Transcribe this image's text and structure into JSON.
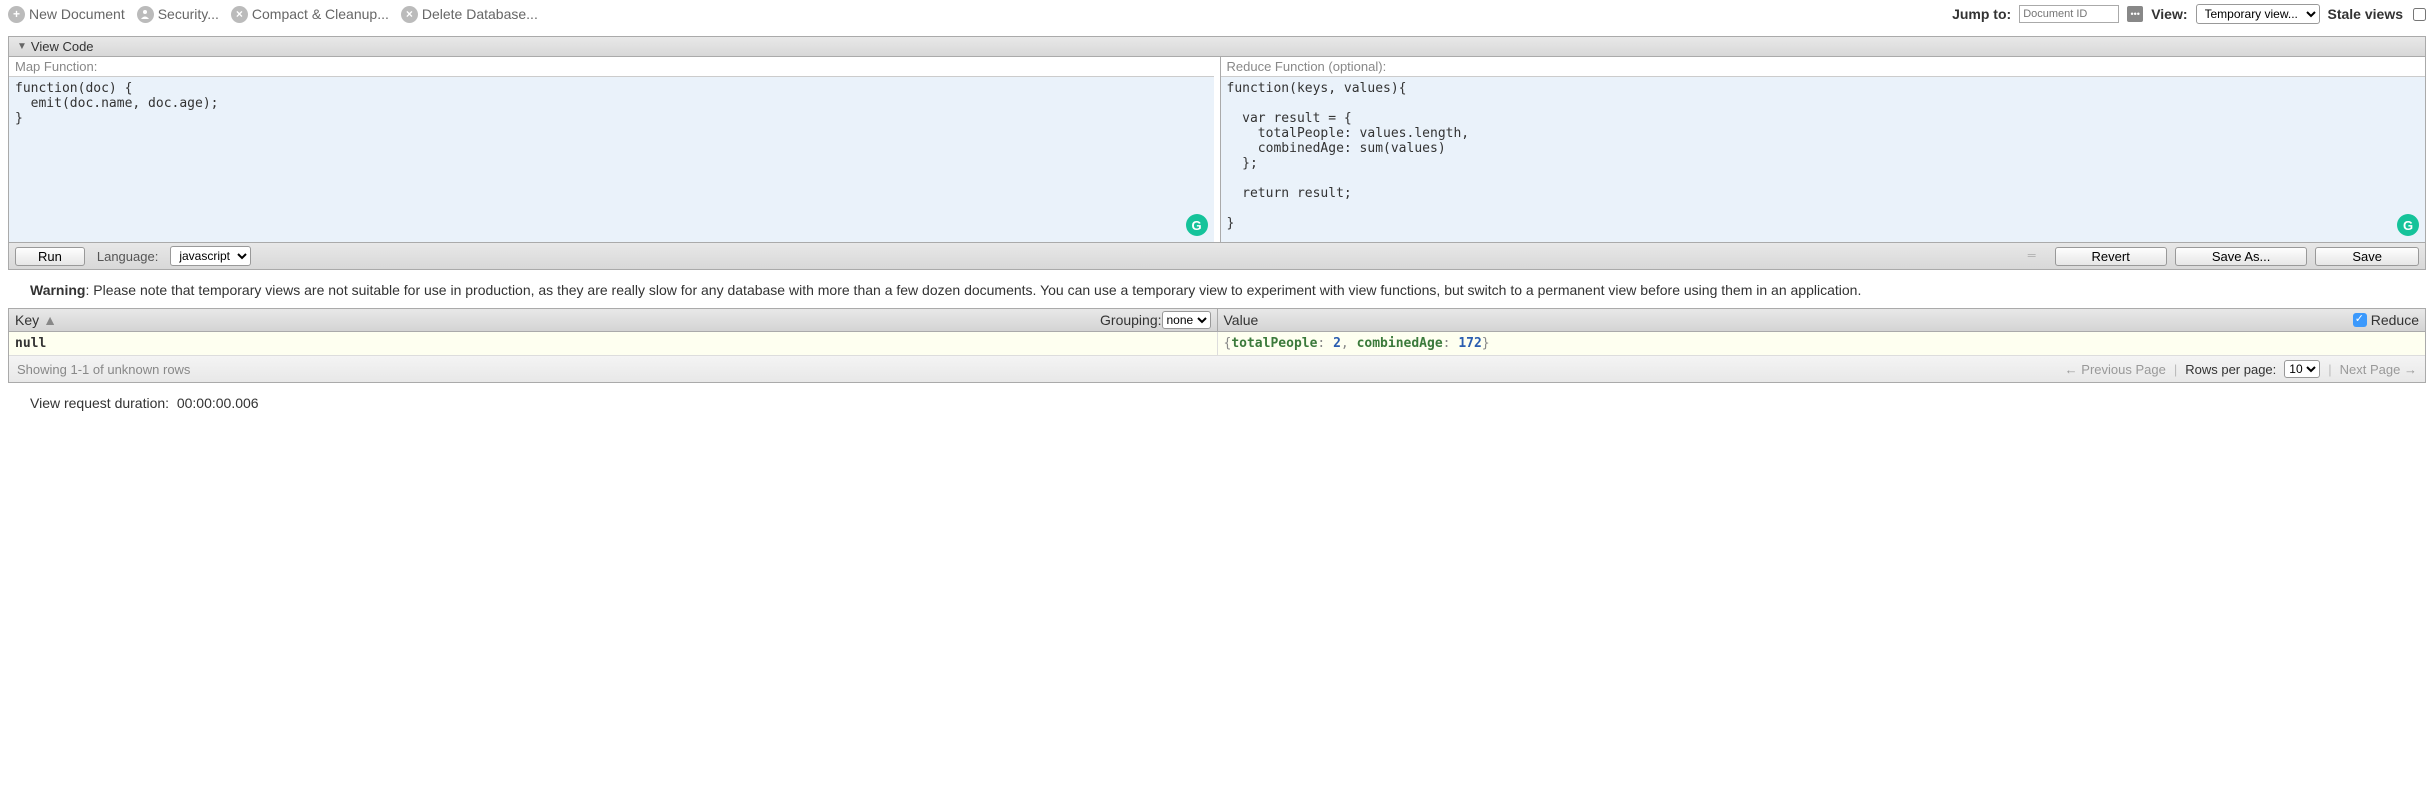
{
  "toolbar": {
    "newDocument": "New Document",
    "security": "Security...",
    "compact": "Compact & Cleanup...",
    "delete": "Delete Database...",
    "jumpToLabel": "Jump to:",
    "jumpToPlaceholder": "Document ID",
    "viewLabel": "View:",
    "viewSelected": "Temporary view...",
    "staleViews": "Stale views"
  },
  "viewCode": {
    "header": "View Code",
    "mapLabel": "Map Function:",
    "mapCode": "function(doc) {\n  emit(doc.name, doc.age);\n}",
    "reduceLabel": "Reduce Function (optional):",
    "reduceCode": "function(keys, values){\n\n  var result = {\n    totalPeople: values.length,\n    combinedAge: sum(values)\n  };\n\n  return result;\n\n}",
    "runLabel": "Run",
    "languageLabel": "Language:",
    "languageSelected": "javascript",
    "revertLabel": "Revert",
    "saveAsLabel": "Save As...",
    "saveLabel": "Save"
  },
  "warning": {
    "prefix": "Warning",
    "text": ": Please note that temporary views are not suitable for use in production, as they are really slow for any database with more than a few dozen documents. You can use a temporary view to experiment with view functions, but switch to a permanent view before using them in an application."
  },
  "results": {
    "keyHeader": "Key",
    "groupingLabel": "Grouping:",
    "groupingSelected": "none",
    "valueHeader": "Value",
    "reduceLabel": "Reduce",
    "reduceChecked": true,
    "rows": [
      {
        "key": "null",
        "valueKeys": [
          "totalPeople",
          "combinedAge"
        ],
        "valueNums": [
          "2",
          "172"
        ]
      }
    ],
    "showing": "Showing 1-1 of unknown rows",
    "prevPage": "← Previous Page",
    "rowsPerPageLabel": "Rows per page:",
    "rowsPerPageSelected": "10",
    "nextPage": "Next Page →"
  },
  "duration": {
    "label": "View request duration:",
    "value": "00:00:00.006"
  },
  "chart_data": {
    "type": "table",
    "columns": [
      "Key",
      "Value"
    ],
    "rows": [
      {
        "Key": "null",
        "Value": {
          "totalPeople": 2,
          "combinedAge": 172
        }
      }
    ]
  }
}
